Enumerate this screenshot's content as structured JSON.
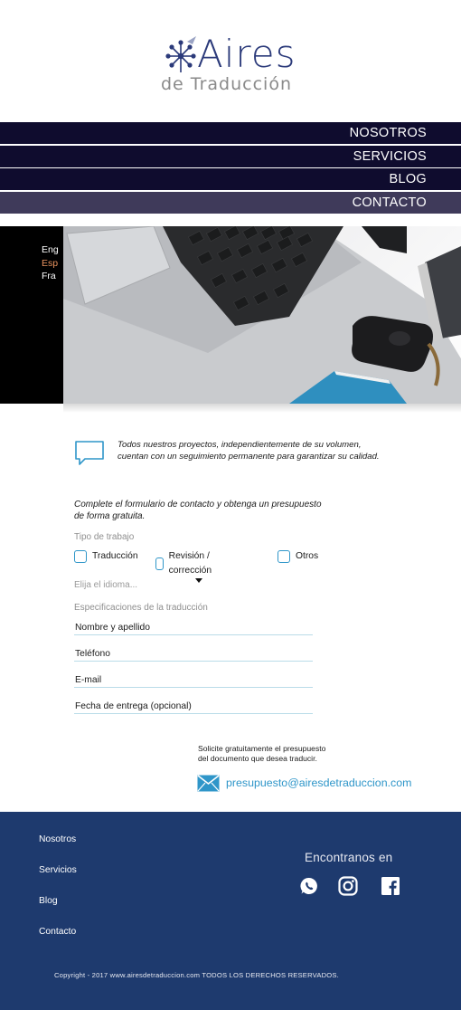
{
  "logo": {
    "title": "Aires",
    "subtitle": "de Traducción"
  },
  "nav": {
    "items": [
      "NOSOTROS",
      "SERVICIOS",
      "BLOG",
      "CONTACTO"
    ],
    "active": "CONTACTO"
  },
  "languages": {
    "items": [
      "Eng",
      "Esp",
      "Fra"
    ],
    "active": "Esp"
  },
  "info": {
    "icon": "speech-bubble-icon",
    "text_line1": "Todos nuestros proyectos, independientemente de su volumen,",
    "text_line2": "cuentan con un seguimiento permanente para garantizar su calidad."
  },
  "form": {
    "intro_line1": "Complete el formulario de contacto y obtenga un presupuesto",
    "intro_line2": "de forma gratuita.",
    "tipo_label": "Tipo de trabajo",
    "checkboxes": [
      "Traducción",
      "Revisión / corrección",
      "Otros"
    ],
    "select_placeholder": "Elija el idioma...",
    "spec_label": "Especificaciones de la traducción",
    "fields": {
      "name": "Nombre y apellido",
      "phone": "Teléfono",
      "email": "E-mail",
      "date": "Fecha de entrega (opcional)"
    }
  },
  "quote": {
    "line1": "Solicite gratuitamente el presupuesto",
    "line2": "del documento que desea traducir.",
    "email": "presupuesto@airesdetraduccion.com"
  },
  "footer": {
    "links": [
      "Nosotros",
      "Servicios",
      "Blog",
      "Contacto"
    ],
    "social_title": "Encontranos en",
    "social_icons": [
      "whatsapp-icon",
      "instagram-icon",
      "facebook-icon"
    ],
    "copyright": "Copyright - 2017 www.airesdetraduccion.com TODOS LOS DERECHOS RESERVADOS."
  },
  "colors": {
    "nav_bg": "#0f0c2e",
    "nav_active": "#3f3a5a",
    "accent_blue": "#2f96c9",
    "footer_bg": "#1e3a6e",
    "lang_active": "#e8935f",
    "logo_blue": "#2b3a7a"
  }
}
